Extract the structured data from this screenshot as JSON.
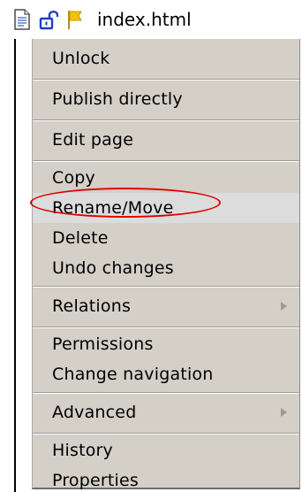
{
  "header": {
    "title": "index.html",
    "icons": [
      "document-icon",
      "unlock-icon",
      "flag-icon"
    ]
  },
  "menu": {
    "groups": [
      {
        "items": [
          {
            "label": "Unlock"
          }
        ]
      },
      {
        "items": [
          {
            "label": "Publish directly"
          }
        ]
      },
      {
        "items": [
          {
            "label": "Edit page"
          }
        ]
      },
      {
        "items": [
          {
            "label": "Copy"
          },
          {
            "label": "Rename/Move"
          },
          {
            "label": "Delete"
          },
          {
            "label": "Undo changes"
          }
        ]
      },
      {
        "items": [
          {
            "label": "Relations"
          }
        ]
      },
      {
        "items": [
          {
            "label": "Permissions"
          },
          {
            "label": "Change navigation"
          }
        ]
      },
      {
        "items": [
          {
            "label": "Advanced"
          }
        ]
      },
      {
        "items": [
          {
            "label": "History"
          },
          {
            "label": "Properties"
          }
        ]
      }
    ]
  },
  "colors": {
    "menu_bg": "#d4d0c8",
    "annotation_red": "#e00000",
    "unlock_icon": "#1f3fbf",
    "flag_icon": "#f2c200"
  }
}
